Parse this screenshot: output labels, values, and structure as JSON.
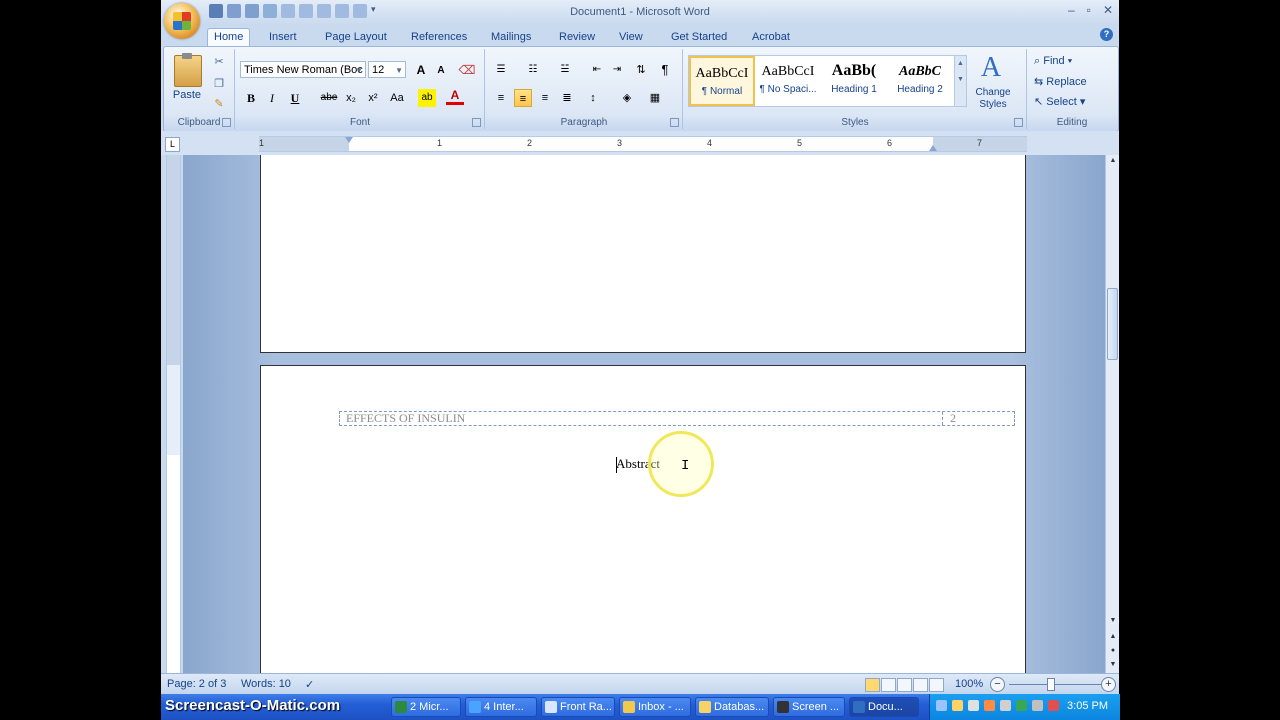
{
  "window": {
    "title": "Document1 - Microsoft Word"
  },
  "tabs": [
    "Home",
    "Insert",
    "Page Layout",
    "References",
    "Mailings",
    "Review",
    "View",
    "Get Started",
    "Acrobat"
  ],
  "clipboard": {
    "paste_label": "Paste",
    "group_label": "Clipboard"
  },
  "font": {
    "name": "Times New Roman (Boc",
    "size": "12",
    "group_label": "Font",
    "buttons": {
      "bold": "B",
      "italic": "I",
      "underline": "U",
      "strike": "abe",
      "subscript": "x₂",
      "superscript": "x²",
      "case": "Aa",
      "grow": "A",
      "shrink": "A"
    }
  },
  "paragraph": {
    "group_label": "Paragraph",
    "show_marks": "¶"
  },
  "styles": {
    "group_label": "Styles",
    "items": [
      {
        "preview": "AaBbCcI",
        "name": "¶ Normal"
      },
      {
        "preview": "AaBbCcI",
        "name": "¶ No Spaci..."
      },
      {
        "preview": "AaBb(",
        "name": "Heading 1"
      },
      {
        "preview": "AaBbC",
        "name": "Heading 2"
      }
    ],
    "change_styles": "Change Styles"
  },
  "editing": {
    "group_label": "Editing",
    "find": "Find",
    "replace": "Replace",
    "select": "Select"
  },
  "ruler": {
    "numbers": [
      "1",
      "1",
      "2",
      "3",
      "4",
      "5",
      "6",
      "7"
    ],
    "corner": "L"
  },
  "document": {
    "header_text": "EFFECTS OF INSULIN",
    "page_number": "2",
    "body_text": "Abstract"
  },
  "status": {
    "page": "Page: 2 of 3",
    "words": "Words: 10",
    "zoom": "100%"
  },
  "taskbar": {
    "watermark": "Screencast-O-Matic.com",
    "buttons": [
      "2 Micr...",
      "4 Inter...",
      "Front Ra...",
      "Inbox - ...",
      "Databas...",
      "Screen ...",
      "Docu..."
    ],
    "clock": "3:05 PM"
  }
}
